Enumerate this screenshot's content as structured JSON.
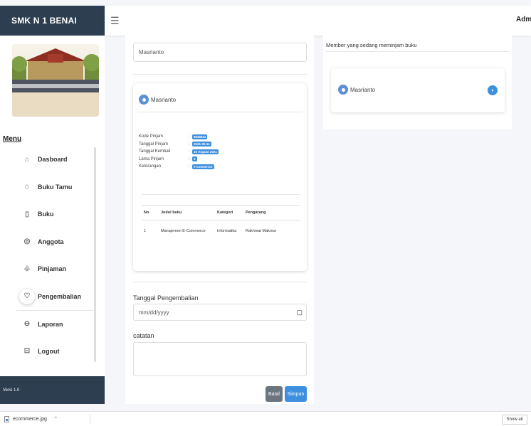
{
  "sidebar": {
    "brand": "SMK N 1 BENAI",
    "menu_title": "Menu",
    "items": [
      {
        "label": "Dasboard",
        "icon": "home-icon"
      },
      {
        "label": "Buku Tamu",
        "icon": "building-icon"
      },
      {
        "label": "Buku",
        "icon": "book-icon"
      },
      {
        "label": "Anggota",
        "icon": "user-circle-icon"
      },
      {
        "label": "Pinjaman",
        "icon": "gift-icon"
      },
      {
        "label": "Pengembalian",
        "icon": "shield-icon"
      },
      {
        "label": "Laporan",
        "icon": "printer-icon"
      },
      {
        "label": "Logout",
        "icon": "logout-icon"
      }
    ],
    "active_item": "Pengembalian",
    "version": "Versi 1.0"
  },
  "header": {
    "user": "Admin"
  },
  "form": {
    "member_field_value": "Masrianto",
    "card": {
      "member_name": "Masrianto",
      "details": [
        {
          "label": "Kode Pinjam",
          "value": "9949511"
        },
        {
          "label": "Tanggal Pinjam",
          "value": "2021-06-11"
        },
        {
          "label": "Tanggal Kembali",
          "value": "15 August 2021"
        },
        {
          "label": "Lama Pinjam",
          "value": "5"
        },
        {
          "label": "Keterangan",
          "value": "e-commerce"
        }
      ],
      "table": {
        "headers": [
          "No",
          "Judul buku",
          "Kategori",
          "Pengarang"
        ],
        "rows": [
          [
            "1",
            "Manajemen E-Commerce",
            "Informatika",
            "Rakhmat Makmur"
          ]
        ]
      }
    },
    "return_date_label": "Tanggal Pengembalian",
    "return_date_placeholder": "mm/dd/yyyy",
    "note_label": "catatan",
    "cancel_label": "Batal",
    "save_label": "Simpan"
  },
  "members_panel": {
    "title": "Member yang sedang meminjam buku",
    "members": [
      {
        "name": "Masrianto"
      }
    ]
  },
  "download_bar": {
    "file_name": "ecommerce.jpg",
    "show_all_label": "Show all"
  },
  "colors": {
    "sidebar_dark": "#2c3e4f",
    "accent_blue": "#3d8fe0",
    "cancel_gray": "#6c757d"
  }
}
